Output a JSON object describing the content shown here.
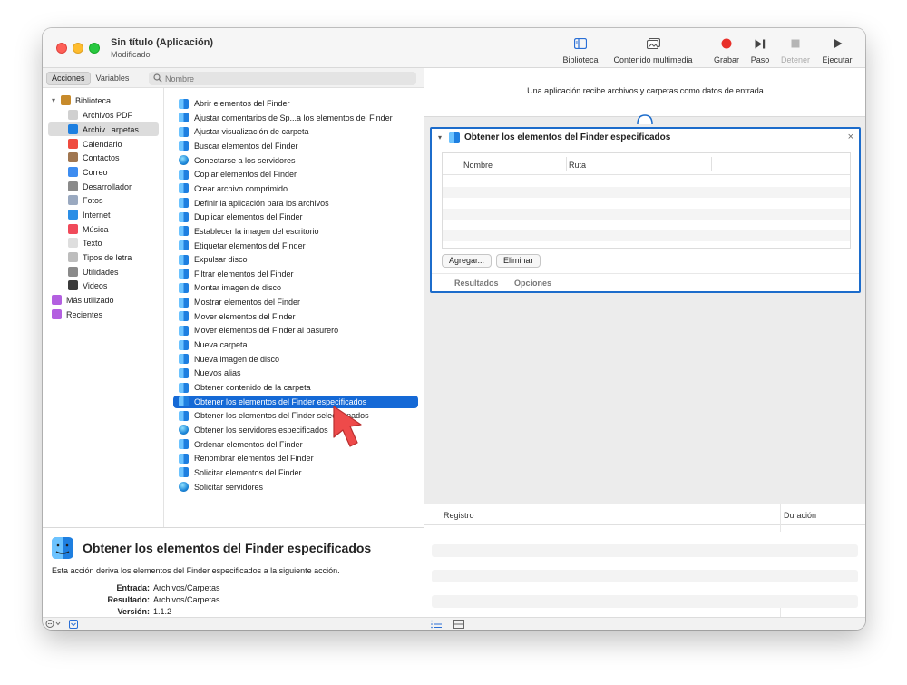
{
  "window": {
    "title": "Sin título (Aplicación)",
    "subtitle": "Modificado"
  },
  "toolbar": {
    "items": [
      {
        "label": "Biblioteca",
        "icon": "sidebar-icon"
      },
      {
        "label": "Contenido multimedia",
        "icon": "photo-icon"
      },
      {
        "label": "Grabar",
        "icon": "record-icon"
      },
      {
        "label": "Paso",
        "icon": "step-icon"
      },
      {
        "label": "Detener",
        "icon": "stop-icon"
      },
      {
        "label": "Ejecutar",
        "icon": "play-icon"
      }
    ],
    "record_color": "#e8302a"
  },
  "sidebar_tabs": {
    "actions": "Acciones",
    "variables": "Variables",
    "search_placeholder": "Nombre"
  },
  "library": [
    {
      "label": "Biblioteca",
      "icon": "library-icon",
      "color": "#c78a2b"
    },
    {
      "label": "Archivos PDF",
      "icon": "pdf-icon",
      "color": "#d0d0d0"
    },
    {
      "label": "Archiv...arpetas",
      "icon": "finder-icon",
      "color": "#1e7fe0"
    },
    {
      "label": "Calendario",
      "icon": "calendar-icon",
      "color": "#ef4b3f"
    },
    {
      "label": "Contactos",
      "icon": "contacts-icon",
      "color": "#a07650"
    },
    {
      "label": "Correo",
      "icon": "mail-icon",
      "color": "#3d8cf0"
    },
    {
      "label": "Desarrollador",
      "icon": "developer-icon",
      "color": "#8a8a8a"
    },
    {
      "label": "Fotos",
      "icon": "photos-icon",
      "color": "#9aa9c0"
    },
    {
      "label": "Internet",
      "icon": "internet-icon",
      "color": "#2b8ee6"
    },
    {
      "label": "Música",
      "icon": "music-icon",
      "color": "#f04a5a"
    },
    {
      "label": "Texto",
      "icon": "text-icon",
      "color": "#dedede"
    },
    {
      "label": "Tipos de letra",
      "icon": "fonts-icon",
      "color": "#bdbdbd"
    },
    {
      "label": "Utilidades",
      "icon": "utilities-icon",
      "color": "#8a8a8a"
    },
    {
      "label": "Videos",
      "icon": "videos-icon",
      "color": "#3a3a3a"
    },
    {
      "label": "Más utilizado",
      "icon": "smart-folder-icon",
      "color": "#b35fe0"
    },
    {
      "label": "Recientes",
      "icon": "smart-folder-icon",
      "color": "#b35fe0"
    }
  ],
  "actions": [
    {
      "label": "Abrir elementos del Finder",
      "icon": "finder"
    },
    {
      "label": "Ajustar comentarios de Sp...a los elementos del Finder",
      "icon": "finder"
    },
    {
      "label": "Ajustar visualización de carpeta",
      "icon": "finder"
    },
    {
      "label": "Buscar elementos del Finder",
      "icon": "finder"
    },
    {
      "label": "Conectarse a los servidores",
      "icon": "globe"
    },
    {
      "label": "Copiar elementos del Finder",
      "icon": "finder"
    },
    {
      "label": "Crear archivo comprimido",
      "icon": "finder"
    },
    {
      "label": "Definir la aplicación para los archivos",
      "icon": "finder"
    },
    {
      "label": "Duplicar elementos del Finder",
      "icon": "finder"
    },
    {
      "label": "Establecer la imagen del escritorio",
      "icon": "finder"
    },
    {
      "label": "Etiquetar elementos del Finder",
      "icon": "finder"
    },
    {
      "label": "Expulsar disco",
      "icon": "finder"
    },
    {
      "label": "Filtrar elementos del Finder",
      "icon": "finder"
    },
    {
      "label": "Montar imagen de disco",
      "icon": "finder"
    },
    {
      "label": "Mostrar elementos del Finder",
      "icon": "finder"
    },
    {
      "label": "Mover elementos del Finder",
      "icon": "finder"
    },
    {
      "label": "Mover elementos del Finder al basurero",
      "icon": "finder"
    },
    {
      "label": "Nueva carpeta",
      "icon": "finder"
    },
    {
      "label": "Nueva imagen de disco",
      "icon": "finder"
    },
    {
      "label": "Nuevos alias",
      "icon": "finder"
    },
    {
      "label": "Obtener contenido de la carpeta",
      "icon": "finder"
    },
    {
      "label": "Obtener los elementos del Finder especificados",
      "icon": "finder"
    },
    {
      "label": "Obtener los elementos del Finder seleccionados",
      "icon": "finder"
    },
    {
      "label": "Obtener los servidores especificados",
      "icon": "globe"
    },
    {
      "label": "Ordenar elementos del Finder",
      "icon": "finder"
    },
    {
      "label": "Renombrar elementos del Finder",
      "icon": "finder"
    },
    {
      "label": "Solicitar elementos del Finder",
      "icon": "finder"
    },
    {
      "label": "Solicitar servidores",
      "icon": "globe"
    }
  ],
  "selected_action_index": 21,
  "description": {
    "title": "Obtener los elementos del Finder especificados",
    "text": "Esta acción deriva los elementos del Finder especificados a la siguiente acción.",
    "input_label": "Entrada:",
    "input_value": "Archivos/Carpetas",
    "result_label": "Resultado:",
    "result_value": "Archivos/Carpetas",
    "version_label": "Versión:",
    "version_value": "1.1.2"
  },
  "workflow": {
    "banner": "Una aplicación recibe archivos y carpetas como datos de entrada",
    "card": {
      "title": "Obtener los elementos del Finder especificados",
      "close": "×",
      "col_name": "Nombre",
      "col_path": "Ruta",
      "add_button": "Agregar...",
      "remove_button": "Eliminar",
      "tab_results": "Resultados",
      "tab_options": "Opciones"
    }
  },
  "log": {
    "col_log": "Registro",
    "col_duration": "Duración"
  },
  "colors": {
    "accent": "#1569d6",
    "pointer": "#ee4a4a"
  }
}
